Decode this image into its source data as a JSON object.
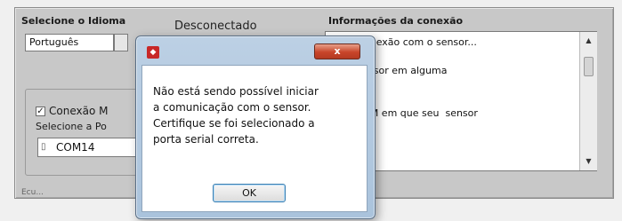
{
  "app": {
    "language_label": "Selecione o Idioma",
    "language_value": "Português",
    "status": "Desconectado",
    "info_label": "Informações da conexão",
    "info_text": "endo conexão com o sensor...\n\n te o sensor em alguma\n\n seu PC.\nne a COM em que seu  sensor\nnectado.",
    "auto_connect_label": "Conexão M",
    "auto_connect_checked": "✓",
    "port_label": "Selecione a Po",
    "port_value": "COM14",
    "bottom_text": "Ecu..."
  },
  "dialog": {
    "icon": "labview-icon",
    "close_label": "x",
    "message": "Não está sendo possível iniciar\na comunicação com o sensor.\nCertifique se foi selecionado a\nporta serial correta.",
    "ok_label": "OK"
  },
  "colors": {
    "panel_bg": "#c8c8c8",
    "dialog_frame": "#aac3dc",
    "close_button": "#c8452a",
    "ok_focus_border": "#3c7fb1"
  }
}
